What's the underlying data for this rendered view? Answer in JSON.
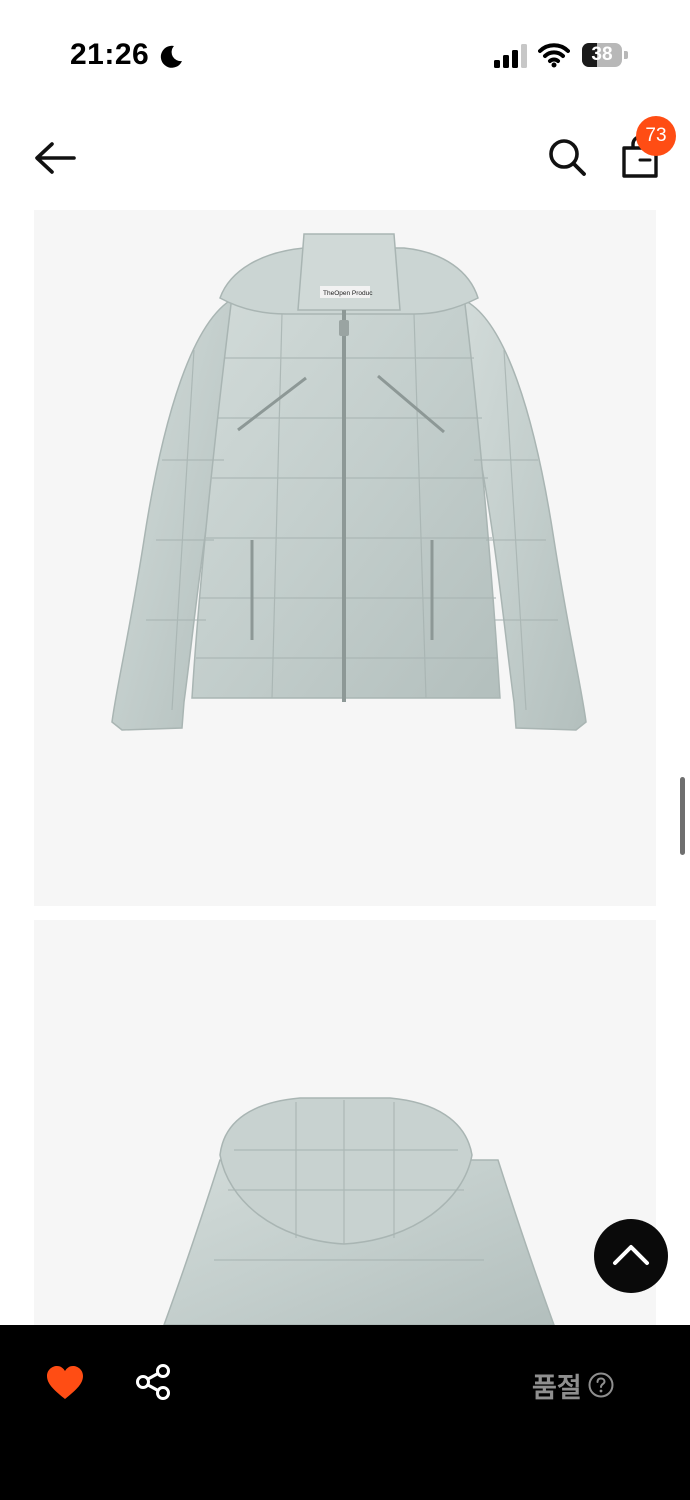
{
  "status_bar": {
    "time": "21:26",
    "battery_level": "38",
    "icons": [
      "moon-icon",
      "cellular-signal-icon",
      "wifi-icon",
      "battery-icon"
    ]
  },
  "header": {
    "icons": [
      "back-arrow-icon",
      "search-icon",
      "shopping-bag-icon"
    ],
    "cart_count": "73"
  },
  "gallery": {
    "images": [
      {
        "name": "jacket-front-image",
        "tag_text": "TheOpen Produc"
      },
      {
        "name": "jacket-back-image"
      }
    ]
  },
  "bottom_bar": {
    "status_label": "품절",
    "icons": [
      "heart-icon",
      "share-icon",
      "help-circle-icon"
    ]
  },
  "colors": {
    "accent": "#ff4d14",
    "bottom_bar_bg": "#000000",
    "image_bg": "#f6f6f6",
    "soldout_text": "#8f8f8f",
    "jacket": "#c4cfcd"
  }
}
